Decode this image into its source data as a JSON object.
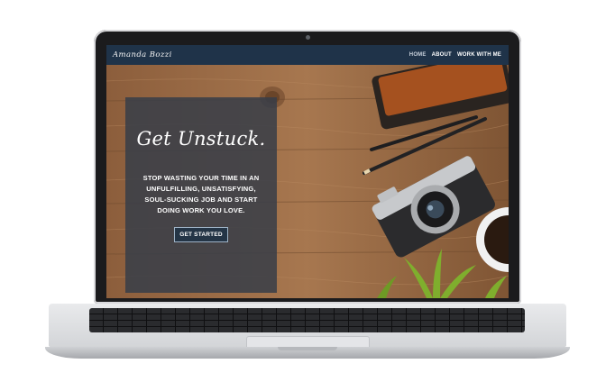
{
  "site": {
    "brand": "Amanda Bozzi",
    "nav": [
      {
        "label": "HOME",
        "active": true
      },
      {
        "label": "ABOUT",
        "active": false
      },
      {
        "label": "WORK WITH ME",
        "active": false
      }
    ]
  },
  "hero": {
    "title": "Get Unstuck.",
    "body": "STOP WASTING YOUR TIME IN AN UNFULFILLING, UNSATISFYING, SOUL-SUCKING JOB AND START DOING WORK YOU LOVE.",
    "cta_label": "GET STARTED"
  },
  "colors": {
    "navbar": "#1f3349",
    "hero_overlay": "#383e48",
    "wood": "#9a6a45"
  },
  "icons": [
    "camera-icon",
    "pencil-icon",
    "wallet-icon",
    "coffee-cup-icon",
    "plant-icon",
    "webcam-icon"
  ]
}
